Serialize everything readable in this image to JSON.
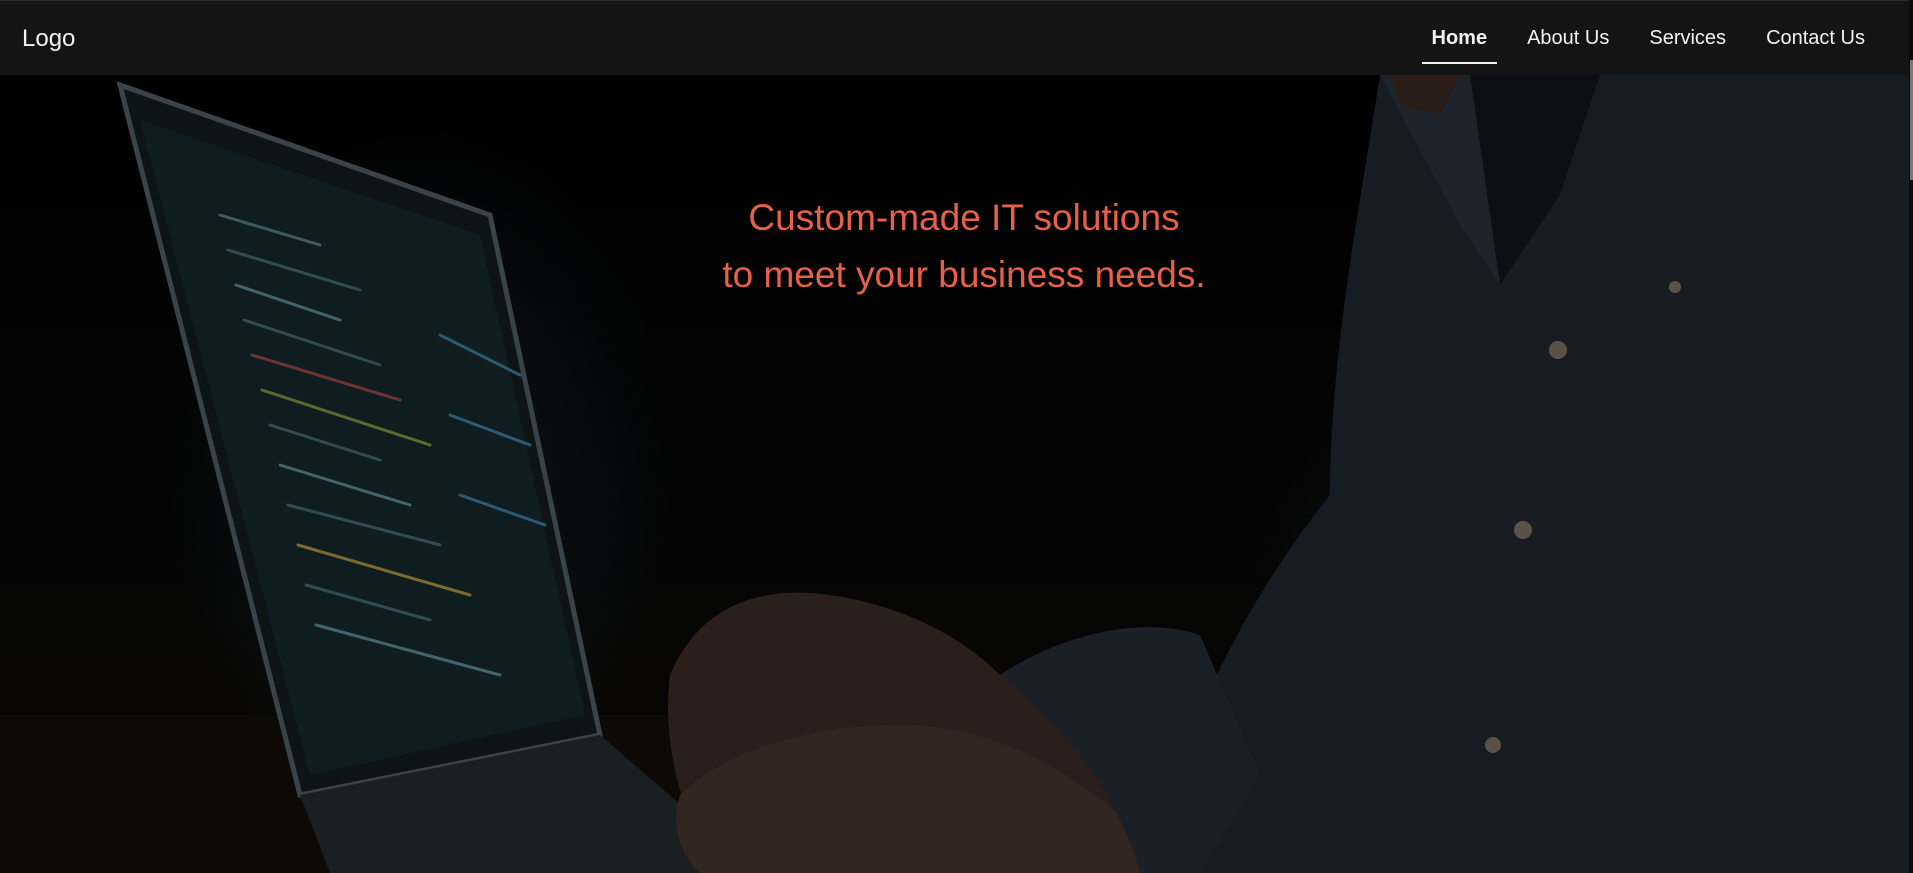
{
  "header": {
    "logo": "Logo",
    "nav": [
      {
        "label": "Home",
        "active": true
      },
      {
        "label": "About Us",
        "active": false
      },
      {
        "label": "Services",
        "active": false
      },
      {
        "label": "Contact Us",
        "active": false
      }
    ]
  },
  "hero": {
    "headline_line1": "Custom-made IT solutions",
    "headline_line2": "to meet your business needs.",
    "headline_color": "#e8604a",
    "background_image": "developer-typing-on-laptop-dark-photo"
  },
  "colors": {
    "navbar_bg": "#141414",
    "nav_text": "#f2f2f2",
    "page_bg": "#000000"
  }
}
